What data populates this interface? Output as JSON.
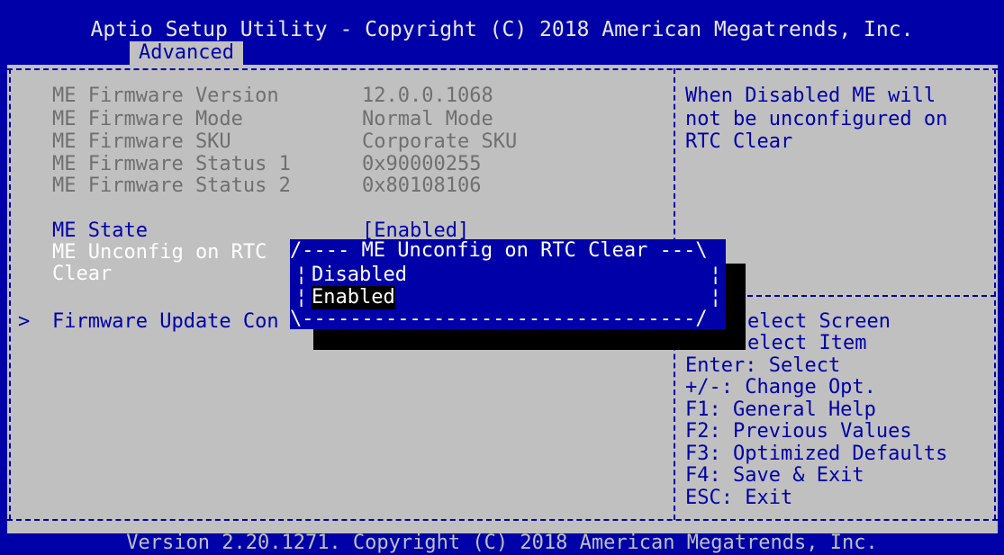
{
  "header": {
    "title": "Aptio Setup Utility - Copyright (C) 2018 American Megatrends, Inc.",
    "active_tab": "Advanced"
  },
  "info_rows": [
    {
      "label": "ME Firmware Version",
      "value": "12.0.0.1068"
    },
    {
      "label": "ME Firmware Mode",
      "value": "Normal Mode"
    },
    {
      "label": "ME Firmware SKU",
      "value": "Corporate SKU"
    },
    {
      "label": "ME Firmware Status 1",
      "value": "0x90000255"
    },
    {
      "label": "ME Firmware Status 2",
      "value": "0x80108106"
    }
  ],
  "settings": {
    "me_state": {
      "label": "ME State",
      "value": "[Enabled]"
    },
    "me_unconfig": {
      "label_line1": "ME Unconfig on RTC",
      "label_line2": "Clear"
    },
    "firmware_update": {
      "prefix": ">",
      "label": "Firmware Update Con"
    }
  },
  "popup": {
    "title_line": "/---- ME Unconfig on RTC Clear ---\\",
    "border_left": "¦",
    "border_right": "¦",
    "bottom_line": "\\---------------------------------/",
    "options": [
      "Disabled",
      "Enabled"
    ],
    "selected": "Enabled"
  },
  "help_panel": {
    "description": [
      "When Disabled ME will",
      "not be unconfigured on",
      "RTC Clear"
    ]
  },
  "key_help": [
    "elect Screen",
    "elect Item",
    "Enter: Select",
    "+/-: Change Opt.",
    "F1: General Help",
    "F2: Previous Values",
    "F3: Optimized Defaults",
    "F4: Save & Exit",
    "ESC: Exit"
  ],
  "footer": {
    "text": "Version 2.20.1271. Copyright (C) 2018 American Megatrends, Inc."
  },
  "colors": {
    "bios_blue": "#0000a8",
    "panel_gray": "#c0c0c0",
    "disabled_text": "#6f6f6f",
    "highlight_black": "#000000"
  }
}
